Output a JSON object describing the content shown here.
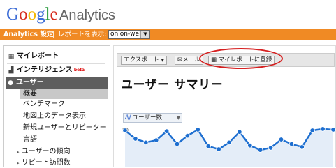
{
  "app": {
    "logo_google": "Google",
    "logo_product": "Analytics"
  },
  "topbar": {
    "settings_label": "Analytics 設定",
    "report_label": "レポートを表示:",
    "profile_value": "onion-web"
  },
  "sidebar": {
    "my_reports": "マイレポート",
    "intelligence": "インテリジェンス",
    "intelligence_badge": "beta",
    "users": "ユーザー",
    "items": [
      "概要",
      "ベンチマーク",
      "地図上のデータ表示",
      "新規ユーザーとリピーター",
      "言語",
      "ユーザーの傾向",
      "リピート訪問数"
    ]
  },
  "toolbar": {
    "export_label": "エクスポート",
    "mail_label": "メール",
    "add_dashboard_label": "マイレポートに登録"
  },
  "page": {
    "title": "ユーザー サマリー"
  },
  "chart": {
    "metric_label": "ユーザー数",
    "y_tick_top": "50"
  },
  "chart_data": {
    "type": "area",
    "series": [
      {
        "values": [
          49,
          38,
          33,
          36,
          48,
          31,
          42,
          50,
          28,
          24,
          33,
          47,
          29,
          23,
          26,
          37,
          31,
          27,
          49,
          51,
          50
        ]
      }
    ],
    "ylim": [
      0,
      50
    ],
    "colors": {
      "line": "#1e6fd0",
      "fill": "#e4edf8"
    }
  },
  "colors": {
    "accent_bar": "#f08a24",
    "selected_header": "#5e5e5e",
    "highlight_ring": "#d62020"
  }
}
